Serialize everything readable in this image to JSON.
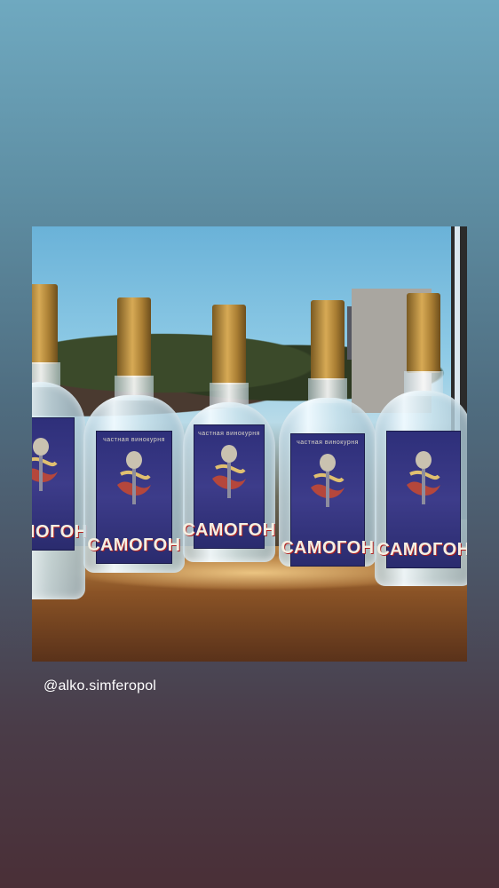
{
  "story": {
    "photo_label": "САМОГОН",
    "label_top_text": "частная винокурня",
    "mention": "@alko.simferopol"
  },
  "colors": {
    "background_top": "#6fa9c0",
    "background_bottom": "#4a2f37",
    "label_blue": "#2e2f7a",
    "cap_gold": "#d7aa55"
  }
}
